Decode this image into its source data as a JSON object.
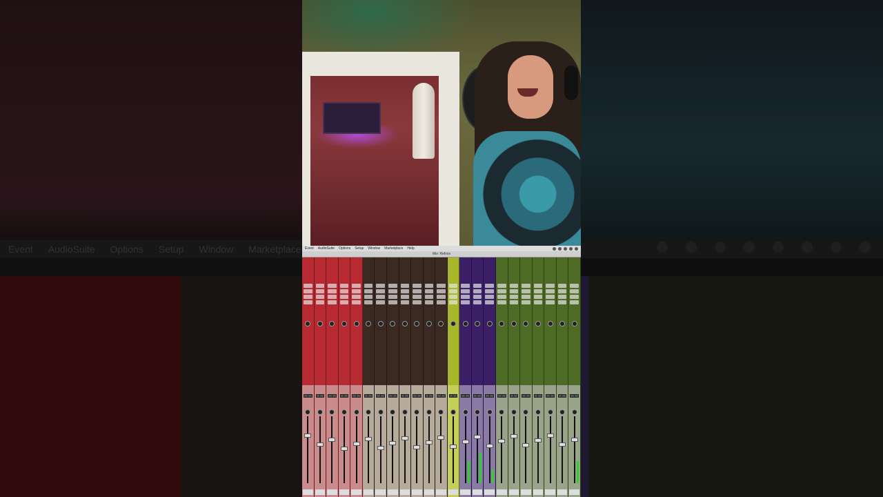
{
  "left_menu": {
    "items": [
      "Event",
      "AudioSuite",
      "Options",
      "Setup",
      "Window",
      "Marketplace"
    ]
  },
  "daw": {
    "menu": [
      "Event",
      "AudioSuite",
      "Options",
      "Setup",
      "Window",
      "Marketplace",
      "Help"
    ],
    "window_title": "Mix: Refvox",
    "colors": {
      "red": "#b82a32",
      "brown": "#3a2a22",
      "lime": "#a9b62a",
      "purple": "#3a1f66",
      "green": "#4d6b24"
    }
  },
  "right_icons": [
    "gear-icon",
    "camera-icon",
    "sun-icon",
    "target-icon",
    "v-icon",
    "pen-icon",
    "eye-icon",
    "ruler-icon",
    "clock-icon"
  ]
}
